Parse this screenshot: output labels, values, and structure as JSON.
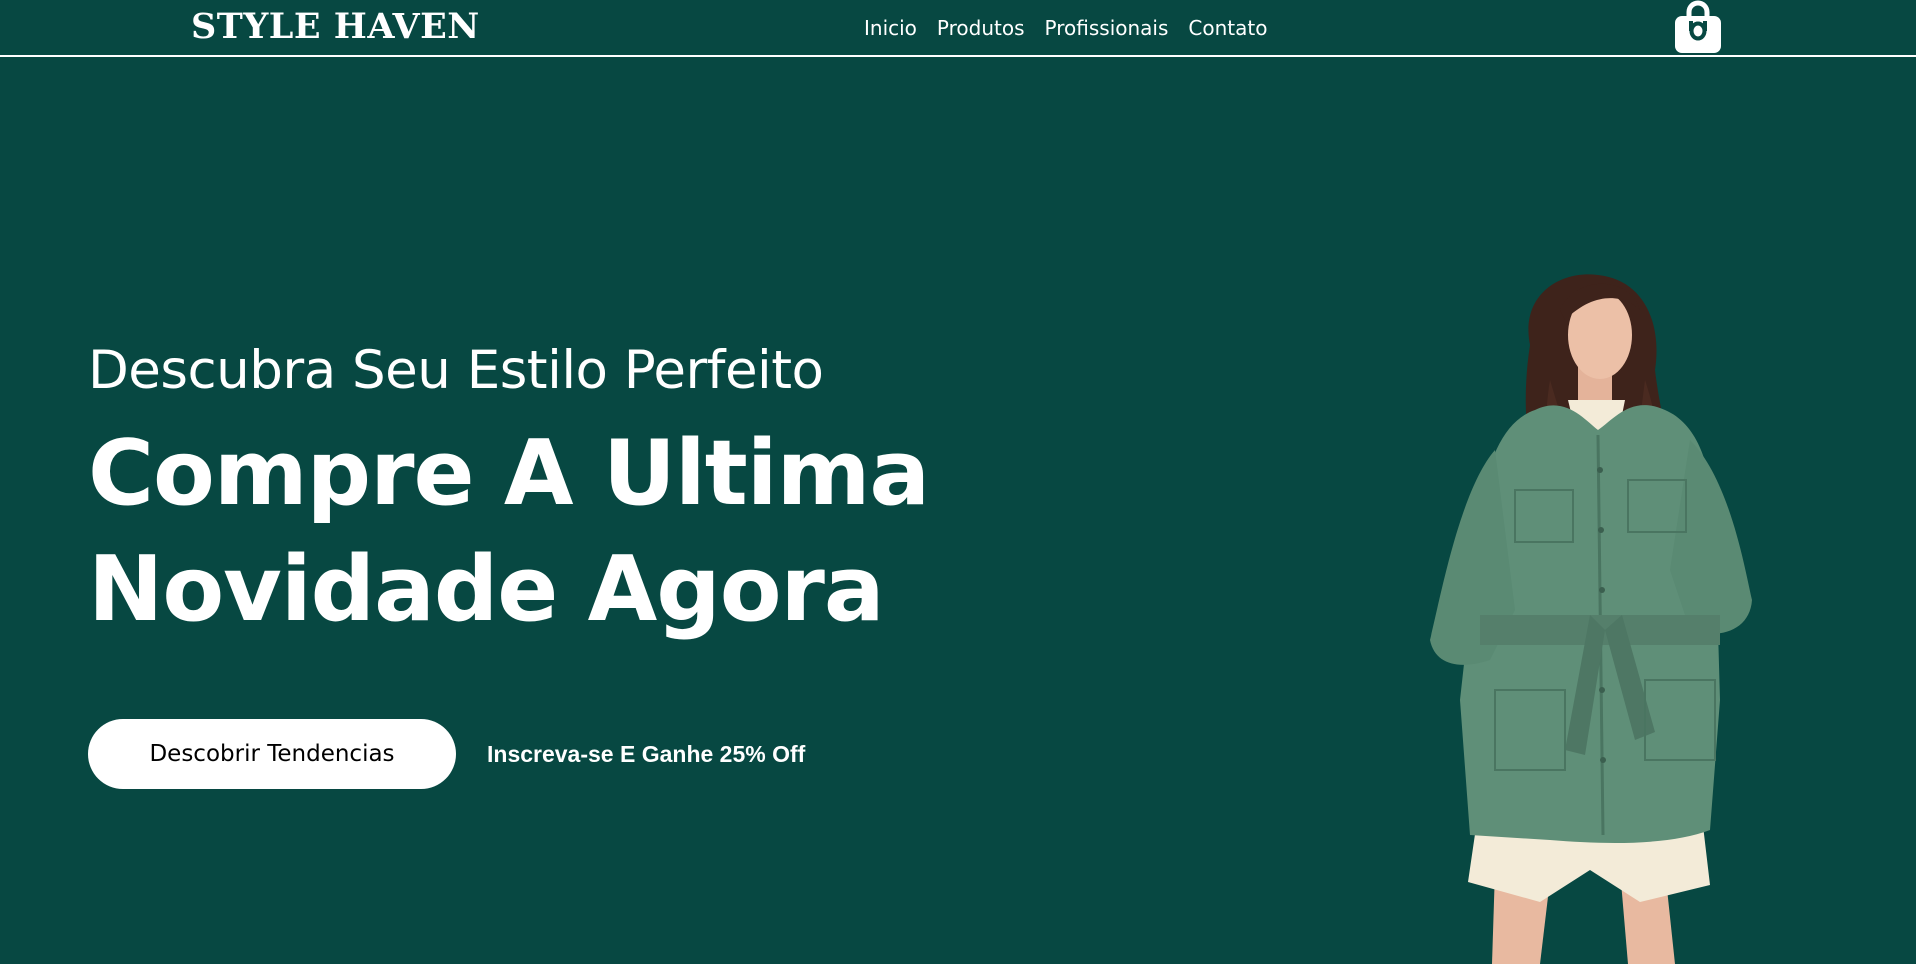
{
  "header": {
    "brand": "STYLE HAVEN",
    "nav": [
      {
        "label": "Inicio"
      },
      {
        "label": "Produtos"
      },
      {
        "label": "Profissionais"
      },
      {
        "label": "Contato"
      }
    ],
    "cart_icon": "shopping-bag-icon"
  },
  "hero": {
    "subtitle": "Descubra Seu Estilo Perfeito",
    "title_line1": "Compre A Ultima",
    "title_line2": "Novidade Agora",
    "cta_label": "Descobrir Tendencias",
    "promo_text": "Inscreva-se E Ganhe 25% Off",
    "image": "model-in-green-jacket"
  },
  "colors": {
    "background": "#074842",
    "text": "#ffffff",
    "button_bg": "#ffffff",
    "button_text": "#000000",
    "jacket": "#5f8f78"
  }
}
